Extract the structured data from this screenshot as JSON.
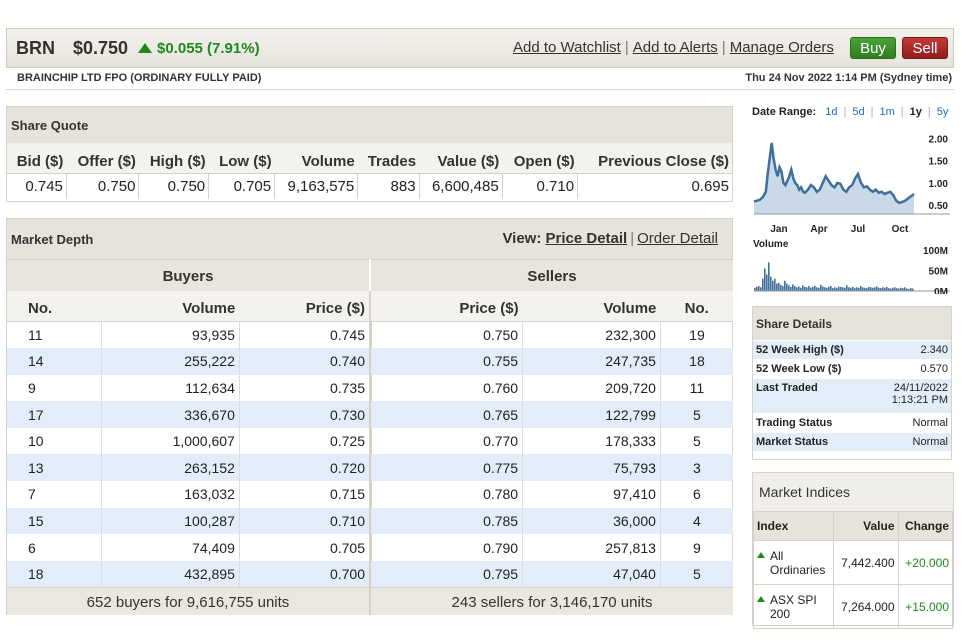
{
  "header": {
    "code": "BRN",
    "price": "$0.750",
    "change": "$0.055 (7.91%)",
    "links": [
      "Add to Watchlist",
      "Add to Alerts",
      "Manage Orders"
    ],
    "buy_label": "Buy",
    "sell_label": "Sell",
    "company": "BRAINCHIP LTD FPO (ORDINARY FULLY PAID)",
    "timestamp": "Thu 24 Nov 2022 1:14 PM (Sydney time)",
    "up_color": "#1e8a1e"
  },
  "share_quote": {
    "title": "Share Quote",
    "headers": [
      "Bid ($)",
      "Offer ($)",
      "High ($)",
      "Low ($)",
      "Volume",
      "Trades",
      "Value ($)",
      "Open ($)",
      "Previous Close ($)"
    ],
    "values": [
      "0.745",
      "0.750",
      "0.750",
      "0.705",
      "9,163,575",
      "883",
      "6,600,485",
      "0.710",
      "0.695"
    ]
  },
  "market_depth": {
    "title": "Market Depth",
    "view_label": "View:",
    "view_price": "Price Detail",
    "view_order": "Order Detail",
    "buyers": {
      "title": "Buyers",
      "headers": [
        "No.",
        "Volume",
        "Price ($)"
      ],
      "rows": [
        [
          "11",
          "93,935",
          "0.745"
        ],
        [
          "14",
          "255,222",
          "0.740"
        ],
        [
          "9",
          "112,634",
          "0.735"
        ],
        [
          "17",
          "336,670",
          "0.730"
        ],
        [
          "10",
          "1,000,607",
          "0.725"
        ],
        [
          "13",
          "263,152",
          "0.720"
        ],
        [
          "7",
          "163,032",
          "0.715"
        ],
        [
          "15",
          "100,287",
          "0.710"
        ],
        [
          "6",
          "74,409",
          "0.705"
        ],
        [
          "18",
          "432,895",
          "0.700"
        ]
      ],
      "summary": "652 buyers for 9,616,755 units"
    },
    "sellers": {
      "title": "Sellers",
      "headers": [
        "Price ($)",
        "Volume",
        "No."
      ],
      "rows": [
        [
          "0.750",
          "232,300",
          "19"
        ],
        [
          "0.755",
          "247,735",
          "18"
        ],
        [
          "0.760",
          "209,720",
          "11"
        ],
        [
          "0.765",
          "122,799",
          "5"
        ],
        [
          "0.770",
          "178,333",
          "5"
        ],
        [
          "0.775",
          "75,793",
          "3"
        ],
        [
          "0.780",
          "97,410",
          "6"
        ],
        [
          "0.785",
          "36,000",
          "4"
        ],
        [
          "0.790",
          "257,813",
          "9"
        ],
        [
          "0.795",
          "47,040",
          "5"
        ]
      ],
      "summary": "243 sellers for 3,146,170 units"
    }
  },
  "date_range": {
    "label": "Date Range:",
    "options": [
      "1d",
      "5d",
      "1m",
      "1y",
      "5y"
    ],
    "selected": "1y"
  },
  "chart_data": [
    {
      "type": "area",
      "title": "",
      "x_ticks": [
        "Jan",
        "Apr",
        "Jul",
        "Oct"
      ],
      "y_ticks": [
        "2.00",
        "1.50",
        "1.00",
        "0.50"
      ],
      "ylim": [
        0.3,
        2.1
      ],
      "grid": false,
      "line_color": "#3f6f9a",
      "fill_color": "#c9d9e8",
      "x": [
        0,
        3,
        6,
        9,
        12,
        14,
        16,
        18,
        20,
        22,
        24,
        26,
        28,
        30,
        32,
        34,
        36,
        38,
        40,
        42,
        44,
        46,
        48,
        50,
        52,
        55,
        58,
        61,
        64,
        67,
        70,
        73,
        76,
        79,
        82,
        85,
        88,
        91,
        94,
        97,
        100,
        103,
        106,
        109,
        112,
        115,
        118,
        121,
        124,
        127,
        130,
        133,
        136,
        139,
        142,
        145,
        148,
        151,
        154,
        157,
        160,
        163
      ],
      "values": [
        0.58,
        0.6,
        0.62,
        0.68,
        0.8,
        1.2,
        1.55,
        1.9,
        1.55,
        1.3,
        1.15,
        1.35,
        1.25,
        1.0,
        0.95,
        1.05,
        1.15,
        1.3,
        1.1,
        1.0,
        0.95,
        0.85,
        0.9,
        0.8,
        0.78,
        0.85,
        0.95,
        0.9,
        0.8,
        0.85,
        1.0,
        1.15,
        1.05,
        0.95,
        0.9,
        1.0,
        0.98,
        0.85,
        0.8,
        0.9,
        0.95,
        1.1,
        1.2,
        1.0,
        0.9,
        0.92,
        0.85,
        0.8,
        0.85,
        0.78,
        0.8,
        0.75,
        0.78,
        0.8,
        0.72,
        0.6,
        0.55,
        0.57,
        0.6,
        0.65,
        0.7,
        0.75
      ]
    },
    {
      "type": "bar",
      "title": "Volume",
      "y_ticks": [
        "100M",
        "50M",
        "0M"
      ],
      "ylim": [
        0,
        110
      ],
      "bar_color": "#3f6f9a",
      "values": [
        8,
        10,
        12,
        9,
        30,
        55,
        40,
        70,
        35,
        25,
        30,
        18,
        20,
        15,
        12,
        25,
        18,
        14,
        10,
        16,
        12,
        9,
        11,
        8,
        14,
        10,
        9,
        12,
        8,
        10,
        13,
        9,
        8,
        15,
        11,
        9,
        8,
        10,
        12,
        7,
        9,
        8,
        11,
        10,
        9,
        8,
        14,
        9,
        8,
        10,
        7,
        9,
        8,
        12,
        9,
        8,
        7,
        10,
        9,
        8,
        9,
        11,
        8,
        7,
        9,
        8,
        10,
        7,
        6,
        8,
        9,
        7,
        6,
        8,
        7,
        9,
        6,
        5,
        7,
        6
      ]
    }
  ],
  "share_details": {
    "title": "Share Details",
    "rows": [
      {
        "k": "52 Week High ($)",
        "v": "2.340"
      },
      {
        "k": "52 Week Low ($)",
        "v": "0.570"
      },
      {
        "k": "Last Traded",
        "v": "24/11/2022",
        "v2": "1:13:21 PM"
      },
      {
        "k": "Trading Status",
        "v": "Normal"
      },
      {
        "k": "Market Status",
        "v": "Normal"
      }
    ]
  },
  "market_indices": {
    "title": "Market Indices",
    "headers": [
      "Index",
      "Value",
      "Change"
    ],
    "rows": [
      {
        "name1": "All",
        "name2": "Ordinaries",
        "value": "7,442.400",
        "change": "+20.000"
      },
      {
        "name1": "ASX SPI",
        "name2": "200",
        "value": "7,264.000",
        "change": "+15.000"
      }
    ]
  }
}
